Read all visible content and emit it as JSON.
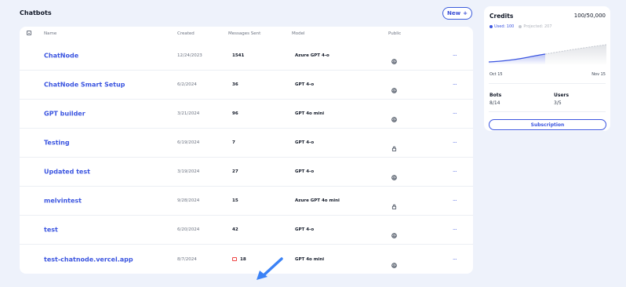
{
  "header": {
    "title": "Chatbots",
    "new_label": "New",
    "new_icon": "plus-icon"
  },
  "table": {
    "columns": {
      "name": "Name",
      "created": "Created",
      "messages": "Messages Sent",
      "model": "Model",
      "public": "Public"
    },
    "rows": [
      {
        "name": "ChatNode",
        "created": "12/24/2023",
        "messages": "1541",
        "model": "Azure GPT 4-o",
        "public": "globe-icon"
      },
      {
        "name": "ChatNode Smart Setup",
        "created": "6/2/2024",
        "messages": "36",
        "model": "GPT 4-o",
        "public": "globe-icon"
      },
      {
        "name": "GPT builder",
        "created": "3/21/2024",
        "messages": "96",
        "model": "GPT 4o mini",
        "public": "globe-icon"
      },
      {
        "name": "Testing",
        "created": "6/19/2024",
        "messages": "7",
        "model": "GPT 4-o",
        "public": "lock-icon"
      },
      {
        "name": "Updated test",
        "created": "3/19/2024",
        "messages": "27",
        "model": "GPT 4-o",
        "public": "globe-icon"
      },
      {
        "name": "melvintest",
        "created": "9/28/2024",
        "messages": "15",
        "model": "Azure GPT 4o mini",
        "public": "lock-icon"
      },
      {
        "name": "test",
        "created": "6/20/2024",
        "messages": "42",
        "model": "GPT 4-o",
        "public": "globe-icon"
      },
      {
        "name": "test-chatnode.vercel.app",
        "created": "8/7/2024",
        "messages": "18",
        "model": "GPT 4o mini",
        "public": "globe-icon"
      }
    ],
    "more_label": "···"
  },
  "credits": {
    "title": "Credits",
    "value": "100/50,000",
    "used_label": "Used: 100",
    "projected_label": "Projected: 207",
    "date_start": "Oct 15",
    "date_end": "Nov 15",
    "bots_label": "Bots",
    "bots_value": "8/14",
    "users_label": "Users",
    "users_value": "3/5",
    "subscription_label": "Subscription"
  },
  "colors": {
    "accent": "#3b55e0",
    "projected": "#c4c8d0",
    "background": "#eef2fb"
  }
}
